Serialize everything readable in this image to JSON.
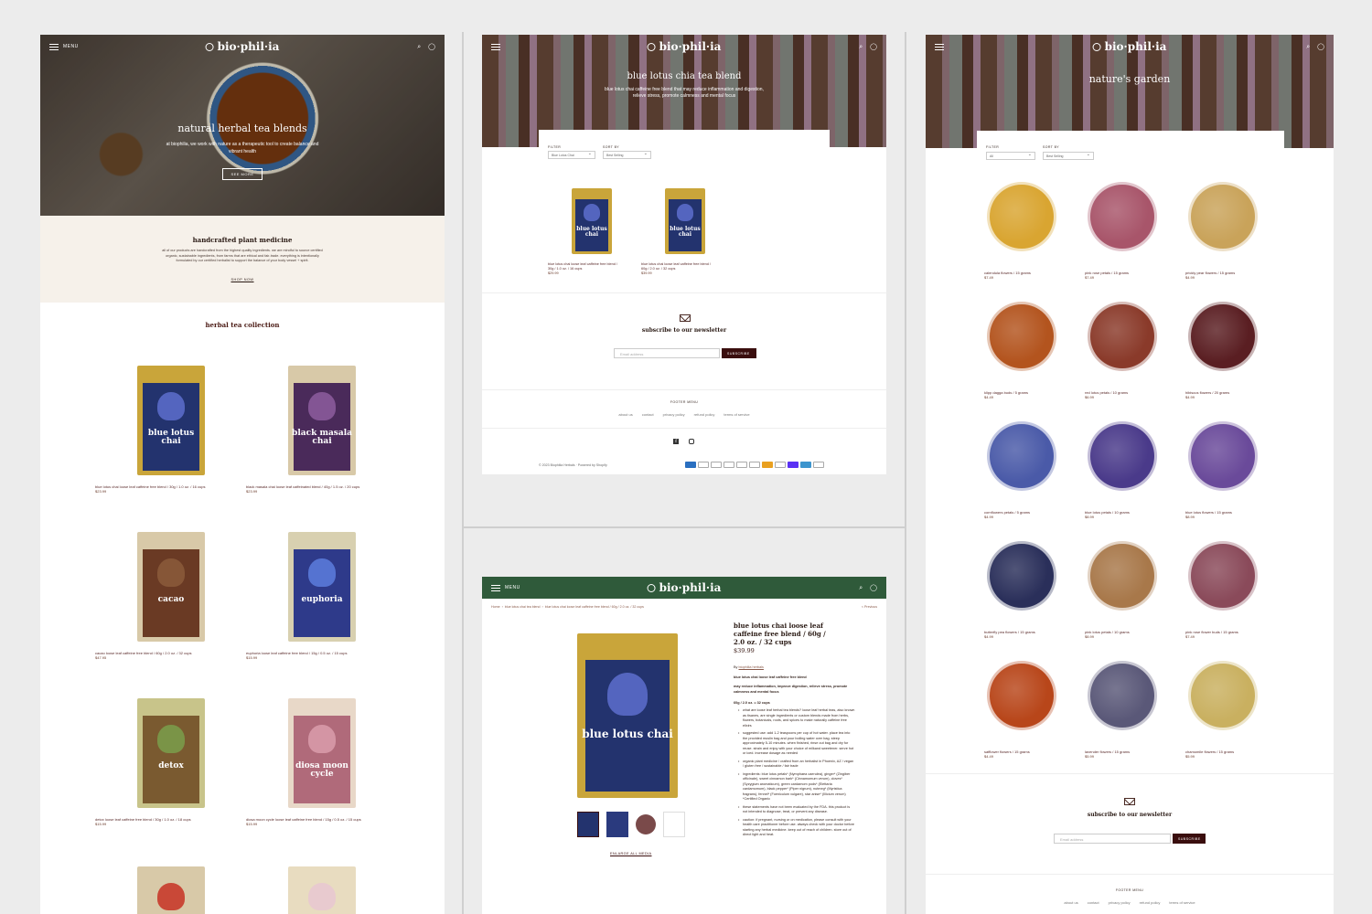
{
  "brand": "bio·phil·ia",
  "menu_label": "MENU",
  "panel1": {
    "hero_title": "natural herbal tea blends",
    "hero_sub": "at biophilia, we work with nature as a therapeutic tool to create balance and vibrant health",
    "hero_btn": "SEE MORE",
    "about_title": "handcrafted plant medicine",
    "about_text": "all of our products are handcrafted from the highest quality ingredients. we are mindful to source certified organic, sustainable ingredients, from farms that are ethical and fair-trade. everything is intentionally formulated by our certified herbalist to support the balance of your body vessel + spirit.",
    "about_btn": "SHOP NOW",
    "collection_title": "herbal tea collection",
    "products": [
      {
        "pack": "blue lotus chai",
        "caption": "blue lotus chai loose leaf caffeine free blend / 30g / 1.0 oz. / 16 cups",
        "price": "$23.99"
      },
      {
        "pack": "black masala chai",
        "caption": "black masala chai loose leaf caffeinated blend / 40g / 1.5 oz. / 20 cups",
        "price": "$23.99"
      },
      {
        "pack": "cacao",
        "caption": "cacao loose leaf caffeine free blend / 60g / 2.0 oz. / 32 cups",
        "price": "$47.95"
      },
      {
        "pack": "euphoria",
        "caption": "euphoria loose leaf caffeine free blend / 15g / 0.5 oz. / 15 cups",
        "price": "$15.99"
      },
      {
        "pack": "detox",
        "caption": "detox loose leaf caffeine free blend / 30g / 1.0 oz. / 18 cups",
        "price": "$15.99"
      },
      {
        "pack": "diosa moon cycle",
        "caption": "diosa moon cycle loose leaf caffeine free blend / 15g / 0.5 oz. / 15 cups",
        "price": "$15.99"
      }
    ]
  },
  "panel2": {
    "hero_title": "blue lotus chia tea blend",
    "hero_sub": "blue lotus chai caffeine free blend that may reduce inflammation and digestion, relieve stress, promote calmness and mental focus",
    "filter_label": "FILTER",
    "filter_value": "Blue Lotus Chai",
    "sort_label": "SORT BY",
    "sort_value": "Best Selling",
    "products": [
      {
        "pack": "blue lotus chai",
        "caption1": "blue lotus chai loose leaf caffeine free blend /",
        "caption2": "30g / 1.0 oz. / 16 cups",
        "price": "$29.99"
      },
      {
        "pack": "blue lotus chai",
        "caption1": "blue lotus chai loose leaf caffeine free blend /",
        "caption2": "60g / 2.0 oz. / 32 cups",
        "price": "$39.99"
      }
    ],
    "newsletter": "subscribe to our newsletter",
    "email_placeholder": "Email address",
    "subscribe": "SUBSCRIBE",
    "footer_menu": "FOOTER MENU",
    "footer_links": [
      "about us",
      "contact",
      "privacy policy",
      "refund policy",
      "terms of service"
    ],
    "copyright": "© 2023 Biophilia Herbals · Powered by Shopify"
  },
  "panel3": {
    "breadcrumb": [
      "Home",
      "blue lotus chai tea blend",
      "blue lotus chai loose leaf caffeine free blend / 60g / 2.0 oz. / 32 cups"
    ],
    "previous": "< Previous",
    "title": "blue lotus chai loose leaf caffeine free blend / 60g / 2.0 oz. / 32 cups",
    "price": "$39.99",
    "by_label": "By",
    "vendor": "biophilia herbals",
    "subtitle": "blue lotus chai loose leaf caffeine free blend",
    "benefits": "may reduce inflammation, improve digestion, relieve stress, promote calmness and mental focus",
    "size": "60g / 2.0 oz. = 32 cups",
    "bullets": [
      "what are loose leaf herbal tea blends? loose leaf herbal teas, also known as tisanes, are single ingredients or custom blends made from herbs, flowers, botanicals, roots, and spices to make naturally caffeine free elixirs",
      "suggested use: add 1-2 teaspoons per cup of hot water. place tea into the provided muslin bag and pour boiling water over bag. steep approximately 5-10 minutes. when finished, rinse out bag and dry for reuse. strain and enjoy with your choice of milkand sweetener. serve hot or iced. increase dosage as needed",
      "organic plant medicine / crafted from an herbalist in Phoenix, AZ / vegan / gluten free / sustainable / fair trade",
      "ingredients: blue lotus petals* (Nymphaea caerulea), ginger* (Zingiber officinale), sweet cinnamon bark* (Cinnamomum verum), cloves* (Syzygium aromaticum), green cardamom pods* (Elettaria cardamomum), black pepper* (Piper nigrum), nutmeg* (Myristica fragrans), fennel* (Foeniculum vulgare), star anise* (Illicium verum) *Certified Organic",
      "these statements have not been evaluated by the FDA. this product is not intended to diagnose, treat, or prevent any disease.",
      "caution: if pregnant, nursing or on medication, please consult with your health care practitioner before use. always check with your doctor before starting any herbal medicine. keep out of reach of children. store out of direct light and heat."
    ],
    "enlarge": "ENLARGE ALL MEDIA",
    "pack_name": "blue lotus chai"
  },
  "panel4": {
    "hero_title": "nature's garden",
    "filter_label": "FILTER",
    "filter_value": "All",
    "sort_label": "SORT BY",
    "sort_value": "Best Selling",
    "herbs": [
      {
        "caption": "calendula flowers / 15 grams",
        "price": "$7.49",
        "color": "#d9a531"
      },
      {
        "caption": "pink rose petals / 15 grams",
        "price": "$7.49",
        "color": "#a8556a"
      },
      {
        "caption": "prickly pear flowers / 15 grams",
        "price": "$4.99",
        "color": "#c9a35a"
      },
      {
        "caption": "klipp dagga buds / 5 grams",
        "price": "$4.49",
        "color": "#b3541e"
      },
      {
        "caption": "red lotus petals / 10 grams",
        "price": "$6.99",
        "color": "#8a3a2a"
      },
      {
        "caption": "hibiscus flowers / 20 grams",
        "price": "$4.99",
        "color": "#5a1e22"
      },
      {
        "caption": "cornflowers petals / 5 grams",
        "price": "$4.99",
        "color": "#4a5aa8"
      },
      {
        "caption": "blue lotus petals / 10 grams",
        "price": "$8.99",
        "color": "#4a3a8a"
      },
      {
        "caption": "blue lotus flowers / 15 grams",
        "price": "$8.99",
        "color": "#6a4a9a"
      },
      {
        "caption": "butterfly pea flowers / 15 grams",
        "price": "$4.99",
        "color": "#2a2f5a"
      },
      {
        "caption": "pink lotus petals / 10 grams",
        "price": "$8.99",
        "color": "#a8784a"
      },
      {
        "caption": "pink rose flower buds / 15 grams",
        "price": "$7.49",
        "color": "#8a4a5a"
      },
      {
        "caption": "safflower flowers / 15 grams",
        "price": "$4.49",
        "color": "#b8461a"
      },
      {
        "caption": "lavender flowers / 15 grams",
        "price": "$5.99",
        "color": "#5a5878"
      },
      {
        "caption": "chamomile flowers / 15 grams",
        "price": "$5.99",
        "color": "#c9b060"
      }
    ],
    "newsletter": "subscribe to our newsletter",
    "email_placeholder": "Email address",
    "subscribe": "SUBSCRIBE",
    "footer_menu": "FOOTER MENU",
    "footer_links": [
      "about us",
      "contact",
      "privacy policy",
      "refund policy",
      "terms of service"
    ]
  },
  "colors": {
    "accent": "#3a0e0e",
    "green_header": "#2f5a3a",
    "cream": "#f6f1ea"
  }
}
